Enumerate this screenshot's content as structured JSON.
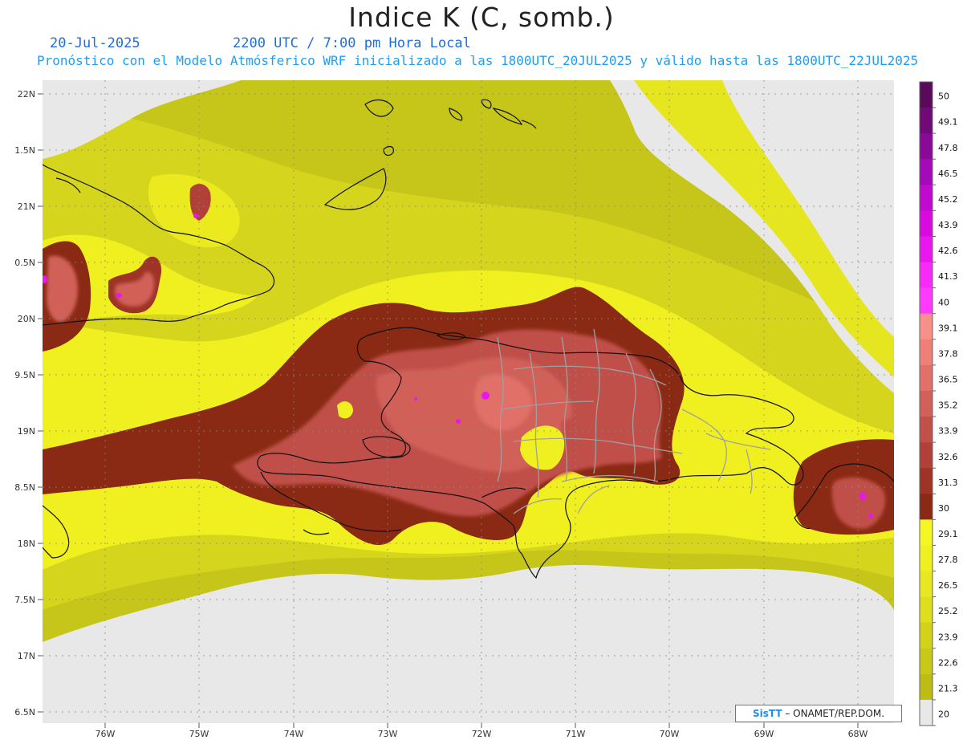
{
  "header": {
    "title": "Indice K (C, somb.)",
    "date": "20-Jul-2025",
    "time": "2200 UTC / 7:00 pm Hora Local",
    "description": "Pronóstico con el Modelo Atmósferico WRF inicializado a las 1800UTC_20JUL2025 y válido hasta las  1800UTC_22JUL2025"
  },
  "axes": {
    "lat_labels": [
      "22N",
      "1.5N",
      "21N",
      "0.5N",
      "20N",
      "9.5N",
      "19N",
      "8.5N",
      "18N",
      "7.5N",
      "17N",
      "6.5N"
    ],
    "lon_labels": [
      "76W",
      "75W",
      "74W",
      "73W",
      "72W",
      "71W",
      "70W",
      "69W",
      "68W"
    ]
  },
  "colorbar": {
    "labels": [
      "50",
      "49.1",
      "47.8",
      "46.5",
      "45.2",
      "43.9",
      "42.6",
      "41.3",
      "40",
      "39.1",
      "37.8",
      "36.5",
      "35.2",
      "33.9",
      "32.6",
      "31.3",
      "30",
      "29.1",
      "27.8",
      "26.5",
      "25.2",
      "23.9",
      "22.6",
      "21.3",
      "20"
    ],
    "colors": [
      "#5a0a5a",
      "#700a78",
      "#8a0a98",
      "#a50ab8",
      "#c00ad0",
      "#d80ae0",
      "#ea16ee",
      "#f82af8",
      "#ff3aff",
      "#f8908a",
      "#ee8078",
      "#e07068",
      "#d06058",
      "#c05048",
      "#b04038",
      "#9e3426",
      "#8a2a14",
      "#f6f624",
      "#f0f020",
      "#e8e820",
      "#dede1c",
      "#d2d218",
      "#c8c818",
      "#bcbc14",
      "#e8e8e8"
    ]
  },
  "credit": {
    "brand": "SisTT",
    "text": "– ONAMET/REP.DOM."
  }
}
